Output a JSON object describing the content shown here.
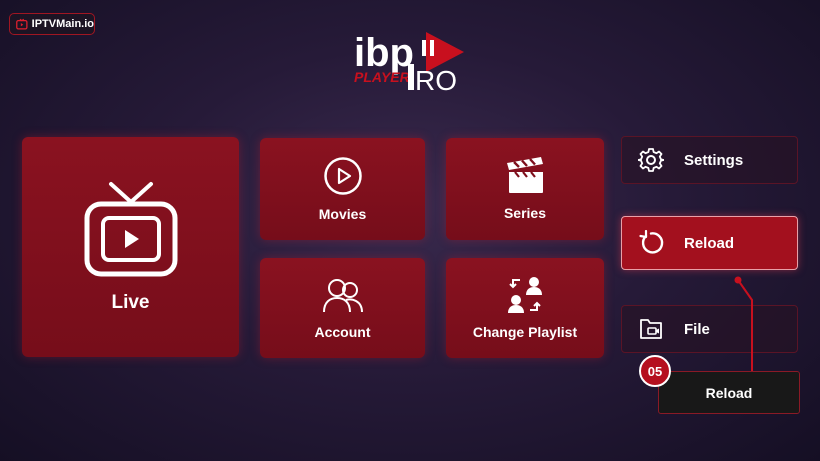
{
  "watermark": {
    "text": "IPTVMain.io",
    "icon": "tv-play-icon"
  },
  "logo": {
    "brand_main": "ibp",
    "brand_sub": "PLAYER",
    "brand_pro": "RO",
    "icon": "ibp-player-pro-logo"
  },
  "tiles": {
    "live": {
      "label": "Live",
      "icon": "tv-icon"
    },
    "movies": {
      "label": "Movies",
      "icon": "play-circle-icon"
    },
    "series": {
      "label": "Series",
      "icon": "clapperboard-icon"
    },
    "account": {
      "label": "Account",
      "icon": "users-icon"
    },
    "change_playlist": {
      "label": "Change Playlist",
      "icon": "switch-users-icon"
    }
  },
  "side_menu": {
    "settings": {
      "label": "Settings",
      "icon": "gear-icon"
    },
    "reload": {
      "label": "Reload",
      "icon": "reload-icon",
      "selected": true
    },
    "file": {
      "label": "File",
      "icon": "file-video-icon"
    }
  },
  "callout": {
    "step": "05",
    "text": "Reload"
  },
  "colors": {
    "accent": "#a3101e",
    "tile": "#7e0f1c",
    "background": "#261a38"
  }
}
